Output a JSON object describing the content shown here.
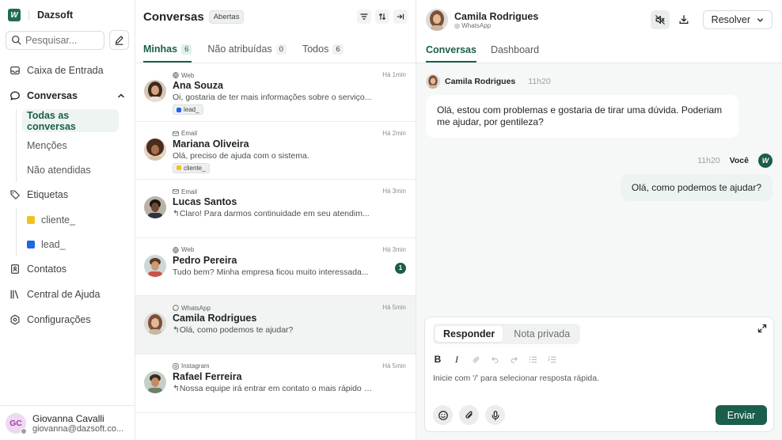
{
  "app": {
    "brand": "Dazsoft",
    "logo_letter": "W"
  },
  "sidebar": {
    "search_placeholder": "Pesquisar...",
    "items": {
      "inbox": "Caixa de Entrada",
      "conversations": "Conversas",
      "all": "Todas as conversas",
      "mentions": "Menções",
      "unattended": "Não atendidas",
      "labels": "Etiquetas",
      "label_cliente": "cliente_",
      "label_lead": "lead_",
      "contacts": "Contatos",
      "help": "Central de Ajuda",
      "settings": "Configurações"
    },
    "colors": {
      "cliente": "#f1c21b",
      "lead": "#1f66e0"
    }
  },
  "user": {
    "initials": "GC",
    "name": "Giovanna Cavalli",
    "email": "giovanna@dazsoft.co..."
  },
  "list": {
    "title": "Conversas",
    "status_pill": "Abertas",
    "tabs": [
      {
        "label": "Minhas",
        "count": "6"
      },
      {
        "label": "Não atribuídas",
        "count": "0"
      },
      {
        "label": "Todos",
        "count": "6"
      }
    ],
    "conversations": [
      {
        "channel": "Web",
        "name": "Ana Souza",
        "message": "Oi, gostaria de ter mais informações sobre o serviço...",
        "time": "Há 1min",
        "tag": "lead_",
        "tag_color": "#1f66e0"
      },
      {
        "channel": "Email",
        "name": "Mariana Oliveira",
        "message": "Olá, preciso de ajuda com o sistema.",
        "time": "Há 2min",
        "tag": "cliente_",
        "tag_color": "#f1c21b"
      },
      {
        "channel": "Email",
        "name": "Lucas Santos",
        "message": "Claro! Para darmos continuidade em seu atendim...",
        "time": "Há 3min"
      },
      {
        "channel": "Web",
        "name": "Pedro Pereira",
        "message": "Tudo bem? Minha empresa ficou muito interessada...",
        "time": "Há 3min",
        "unread": "1"
      },
      {
        "channel": "WhatsApp",
        "name": "Camila Rodrigues",
        "message": "Olá, como podemos te ajudar?",
        "time": "Há 5min"
      },
      {
        "channel": "Instagram",
        "name": "Rafael Ferreira",
        "message": "Nossa equipe irá entrar em contato o mais rápido p...",
        "time": "Há 5min"
      }
    ]
  },
  "chat": {
    "contact_name": "Camila Rodrigues",
    "contact_channel": "WhatsApp",
    "resolve_label": "Resolver",
    "tabs": {
      "conversations": "Conversas",
      "dashboard": "Dashboard"
    },
    "incoming": {
      "author": "Camila Rodrigues",
      "time": "11h20",
      "text": "Olá, estou com problemas e gostaria de tirar uma dúvida. Poderiam me ajudar, por gentileza?"
    },
    "outgoing": {
      "author": "Você",
      "time": "11h20",
      "text": "Olá, como podemos te ajudar?"
    },
    "composer": {
      "mode_reply": "Responder",
      "mode_note": "Nota privada",
      "placeholder": "Inicie com '/' para selecionar resposta rápida.",
      "send_label": "Enviar",
      "bold": "B",
      "italic": "I"
    }
  }
}
